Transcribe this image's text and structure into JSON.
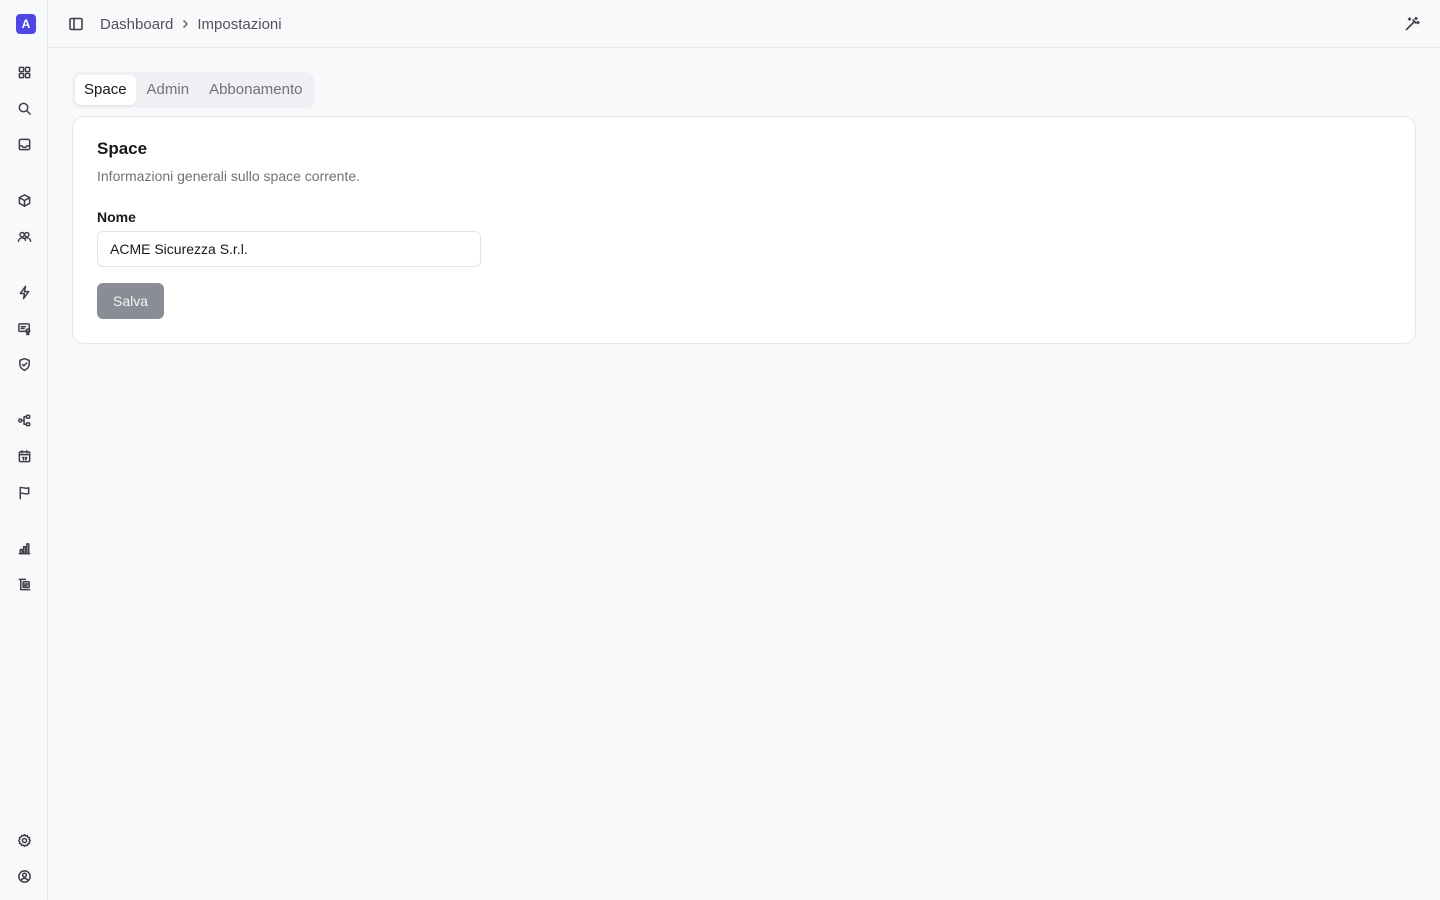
{
  "sidebar": {
    "logo_letter": "A",
    "nav_items": [
      {
        "icon": "dashboard-grid-icon"
      },
      {
        "icon": "search-icon"
      },
      {
        "icon": "inbox-icon"
      },
      {
        "icon": "cube-icon"
      },
      {
        "icon": "users-icon"
      },
      {
        "icon": "lightning-icon"
      },
      {
        "icon": "screen-certificate-icon"
      },
      {
        "icon": "shield-check-icon"
      },
      {
        "icon": "workflow-icon"
      },
      {
        "icon": "calendar-icon"
      },
      {
        "icon": "flag-icon"
      },
      {
        "icon": "bar-chart-icon"
      },
      {
        "icon": "file-tree-icon"
      },
      {
        "icon": "settings-gear-icon"
      },
      {
        "icon": "user-circle-icon"
      }
    ]
  },
  "header": {
    "breadcrumb": {
      "root": "Dashboard",
      "current": "Impostazioni"
    },
    "toggle_icon": "sidebar-toggle-icon",
    "magic_icon": "magic-wand-icon"
  },
  "tabs": [
    "Space",
    "Admin",
    "Abbonamento"
  ],
  "active_tab": "Space",
  "card": {
    "title": "Space",
    "description": "Informazioni generali sullo space corrente.",
    "name_label": "Nome",
    "name_value": "ACME Sicurezza S.r.l.",
    "save_label": "Salva"
  },
  "colors": {
    "accent": "#4f46e5",
    "background": "#f8f9fb",
    "save_button_disabled": "#8b8d96"
  }
}
